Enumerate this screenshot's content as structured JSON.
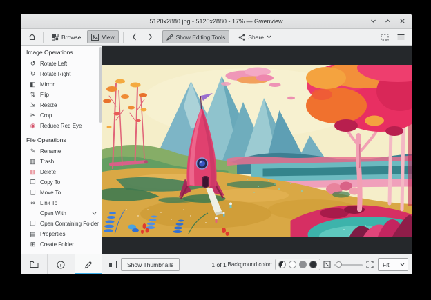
{
  "window": {
    "title": "5120x2880.jpg - 5120x2880 - 17% — Gwenview"
  },
  "toolbar": {
    "browse_label": "Browse",
    "view_label": "View",
    "show_editing_tools_label": "Show Editing Tools",
    "share_label": "Share"
  },
  "sidebar": {
    "image_operations": {
      "title": "Image Operations",
      "items": [
        {
          "label": "Rotate Left",
          "glyph": "↺",
          "color": "#3f4346",
          "name": "sidebar-item-rotate-left",
          "icon": "rotate-left-icon"
        },
        {
          "label": "Rotate Right",
          "glyph": "↻",
          "color": "#3f4346",
          "name": "sidebar-item-rotate-right",
          "icon": "rotate-right-icon"
        },
        {
          "label": "Mirror",
          "glyph": "◧",
          "color": "#3f4346",
          "name": "sidebar-item-mirror",
          "icon": "mirror-icon"
        },
        {
          "label": "Flip",
          "glyph": "⇅",
          "color": "#3f4346",
          "name": "sidebar-item-flip",
          "icon": "flip-icon"
        },
        {
          "label": "Resize",
          "glyph": "⇲",
          "color": "#3f4346",
          "name": "sidebar-item-resize",
          "icon": "resize-icon"
        },
        {
          "label": "Crop",
          "glyph": "✂",
          "color": "#3f4346",
          "name": "sidebar-item-crop",
          "icon": "crop-icon"
        },
        {
          "label": "Reduce Red Eye",
          "glyph": "◉",
          "color": "#d4536a",
          "name": "sidebar-item-reduce-red-eye",
          "icon": "red-eye-icon"
        }
      ]
    },
    "file_operations": {
      "title": "File Operations",
      "items_top": [
        {
          "label": "Rename",
          "glyph": "✎",
          "color": "#3f4346",
          "name": "sidebar-item-rename",
          "icon": "rename-icon"
        },
        {
          "label": "Trash",
          "glyph": "▥",
          "color": "#3f4346",
          "name": "sidebar-item-trash",
          "icon": "trash-icon"
        },
        {
          "label": "Delete",
          "glyph": "▥",
          "color": "#da4453",
          "name": "sidebar-item-delete",
          "icon": "delete-icon"
        },
        {
          "label": "Copy To",
          "glyph": "❐",
          "color": "#3f4346",
          "name": "sidebar-item-copy-to",
          "icon": "copy-icon"
        },
        {
          "label": "Move To",
          "glyph": "❏",
          "color": "#3f4346",
          "name": "sidebar-item-move-to",
          "icon": "move-icon"
        },
        {
          "label": "Link To",
          "glyph": "∞",
          "color": "#3f4346",
          "name": "sidebar-item-link-to",
          "icon": "link-icon"
        }
      ],
      "open_with_label": "Open With",
      "items_bottom": [
        {
          "label": "Open Containing Folder",
          "glyph": "❒",
          "color": "#3f4346",
          "name": "sidebar-item-open-containing-folder",
          "icon": "folder-open-icon"
        },
        {
          "label": "Properties",
          "glyph": "▤",
          "color": "#3f4346",
          "name": "sidebar-item-properties",
          "icon": "properties-icon"
        },
        {
          "label": "Create Folder",
          "glyph": "⊞",
          "color": "#3f4346",
          "name": "sidebar-item-create-folder",
          "icon": "folder-new-icon"
        }
      ]
    }
  },
  "statusbar": {
    "show_thumbnails_label": "Show Thumbnails",
    "page_indicator": "1 of 1",
    "background_color_label": "Background color:",
    "zoom_mode": "Fit"
  },
  "icons": {
    "titlebar": [
      "minimize-icon",
      "maximize-icon",
      "close-icon"
    ],
    "toolbar": [
      "home-icon",
      "browse-grid-icon",
      "view-image-icon",
      "back-icon",
      "forward-icon",
      "pencil-icon",
      "share-icon",
      "chevron-down-icon",
      "fullscreen-icon",
      "hamburger-menu-icon"
    ],
    "tabs": [
      "folder-tab-icon",
      "info-tab-icon",
      "edit-tab-icon"
    ],
    "statusbar": [
      "thumbnail-bar-icon",
      "swatch-auto",
      "swatch-white",
      "swatch-gray",
      "swatch-black",
      "zoom-fit-icon",
      "zoom-slider",
      "zoom-actual-icon"
    ]
  },
  "colors": {
    "accent": "#3daee9",
    "delete_red": "#da4453",
    "canvas_background": "#25282b",
    "chrome_background": "#eff0f1",
    "sidebar_background": "#fbfbfc"
  }
}
